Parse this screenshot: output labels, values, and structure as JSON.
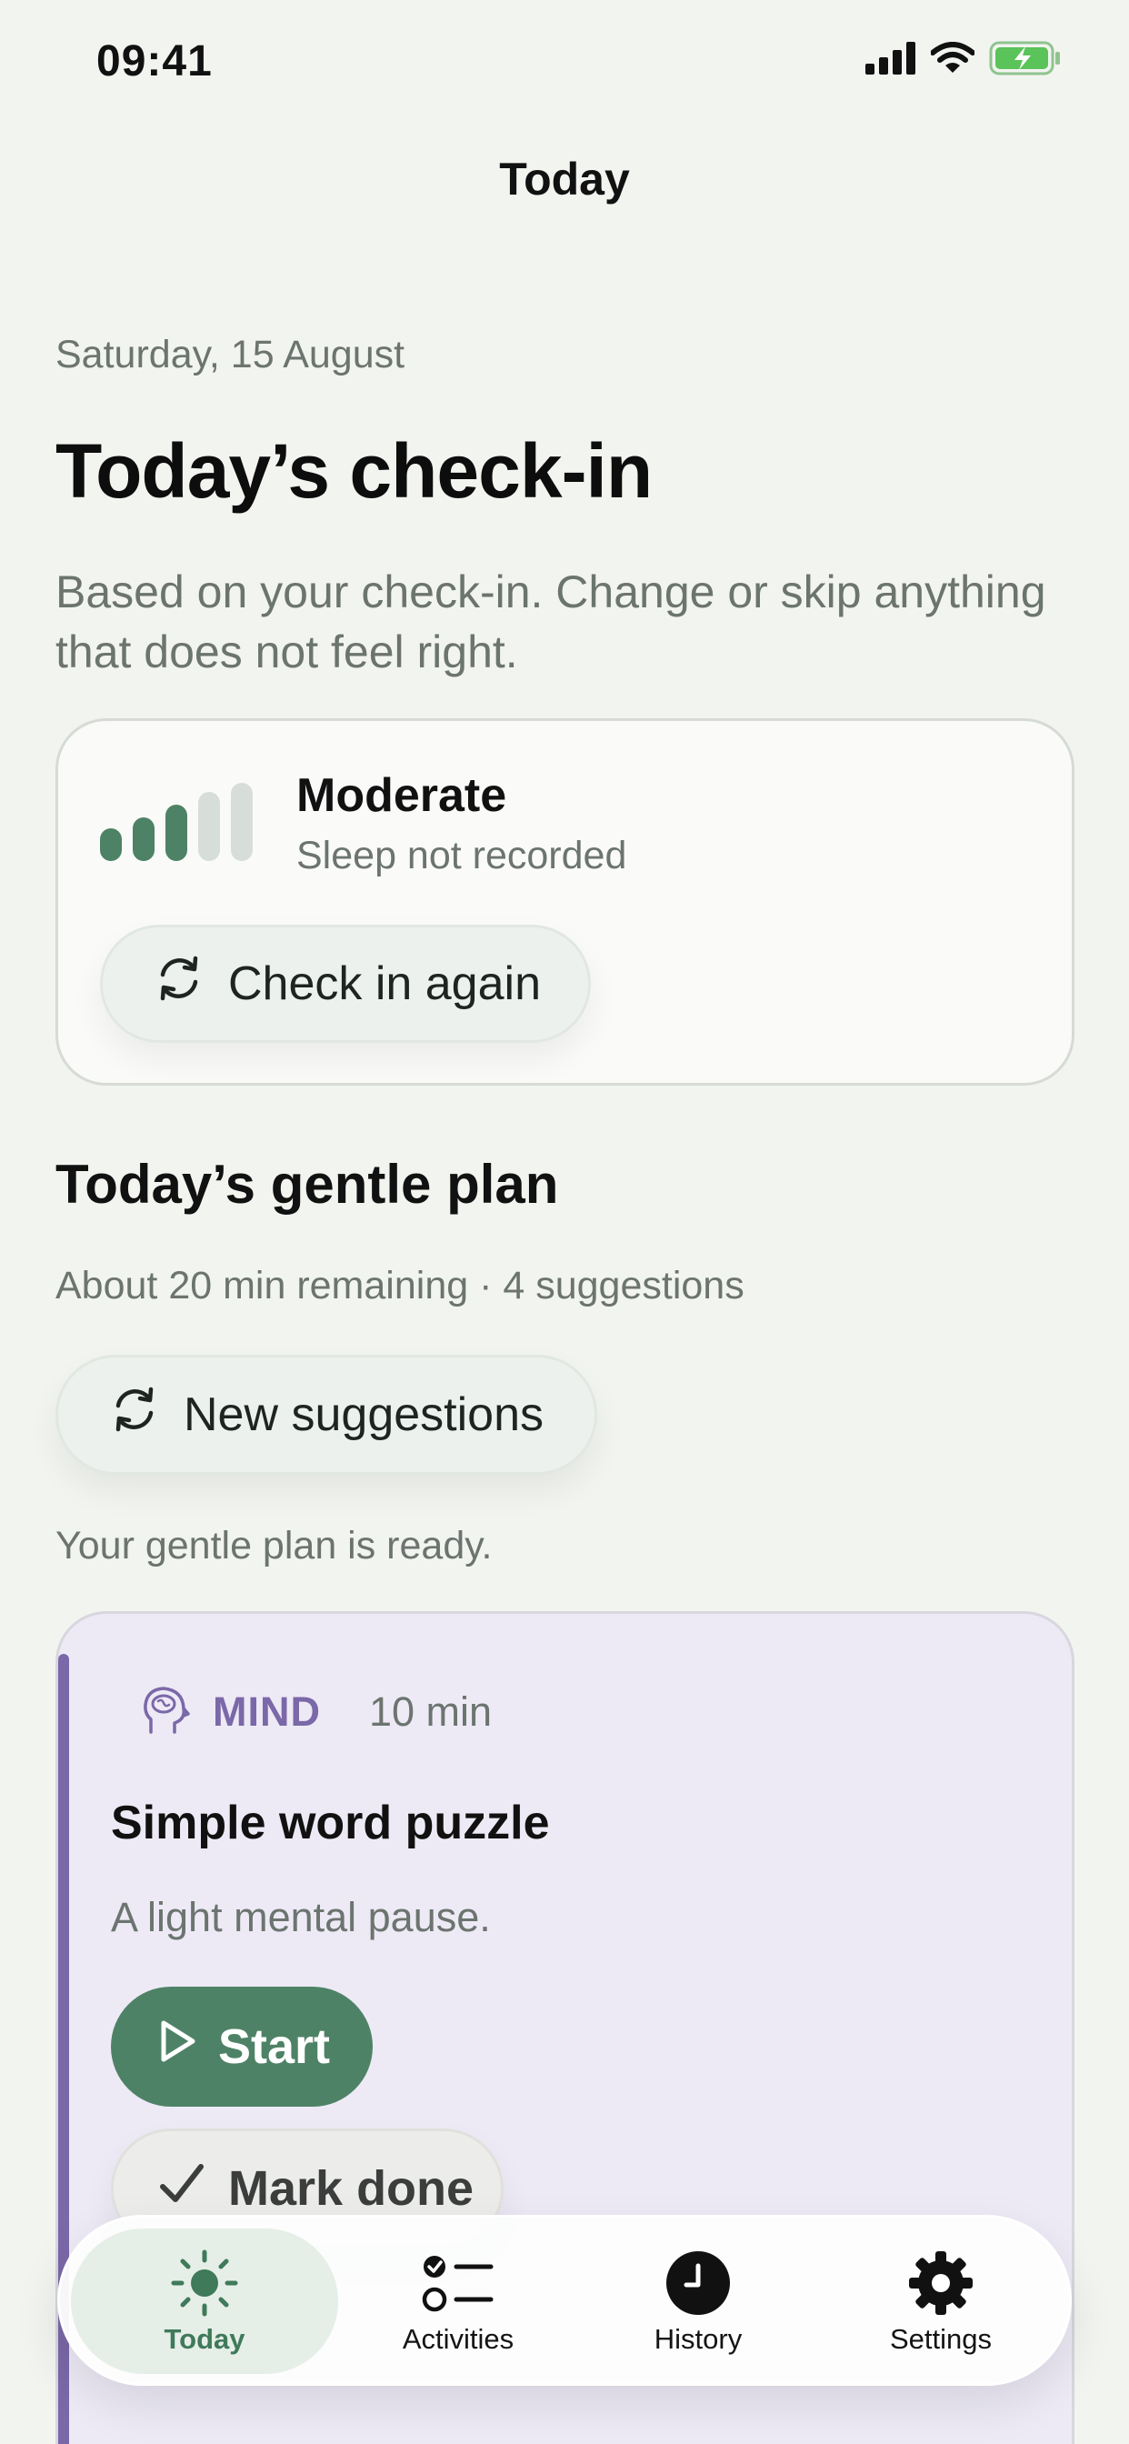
{
  "status_bar": {
    "time": "09:41",
    "icons": [
      "signal-icon",
      "wifi-icon",
      "battery-charging-icon"
    ]
  },
  "nav": {
    "title": "Today"
  },
  "header": {
    "date": "Saturday, 15 August",
    "title": "Today’s check-in",
    "subtitle": "Based on your check-in. Change or skip anything that does not feel right."
  },
  "checkin_card": {
    "level_label": "Moderate",
    "level_value": 3,
    "level_max": 5,
    "sleep_text": "Sleep not recorded",
    "button_label": "Check in again"
  },
  "plan": {
    "heading": "Today’s gentle plan",
    "meta": "About 20 min remaining · 4 suggestions",
    "new_button_label": "New suggestions",
    "status": "Your gentle plan is ready."
  },
  "activity": {
    "category": "MIND",
    "category_icon": "brain-head-icon",
    "duration": "10 min",
    "title": "Simple word puzzle",
    "description": "A light mental pause.",
    "start_label": "Start",
    "done_label": "Mark done"
  },
  "tabs": [
    {
      "label": "Today",
      "icon": "sun-icon",
      "active": true
    },
    {
      "label": "Activities",
      "icon": "checklist-icon",
      "active": false
    },
    {
      "label": "History",
      "icon": "clock-icon",
      "active": false
    },
    {
      "label": "Settings",
      "icon": "gear-icon",
      "active": false
    }
  ],
  "colors": {
    "background": "#f2f4f0",
    "accent_green": "#4e8266",
    "mind_purple": "#7b68a8",
    "muted_text": "#6c746f"
  }
}
